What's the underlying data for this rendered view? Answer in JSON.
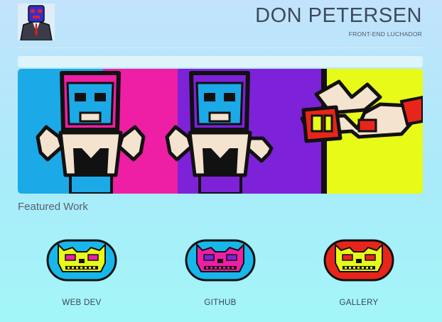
{
  "header": {
    "title": "DON PETERSEN",
    "subtitle": "FRONT-END LUCHADOR"
  },
  "hero": {
    "panel_colors": [
      "#1ba9e8",
      "#ee1fa4",
      "#7d22d8",
      "#e8fa17"
    ],
    "figures": [
      {
        "name": "luchador-pink-mask",
        "mask": "#ee1fa4",
        "mask_inner": "#1ba9e8",
        "shorts": "#1ba9e8"
      },
      {
        "name": "luchador-purple-mask",
        "mask": "#7d22d8",
        "mask_inner": "#1ba9e8",
        "shorts": "#7d22d8"
      },
      {
        "name": "luchador-red-mask",
        "mask": "#e8251b",
        "mask_inner": "#e8fa17"
      }
    ]
  },
  "featured": {
    "heading": "Featured Work",
    "items": [
      {
        "label": "WEB DEV",
        "mask_bg": "#17b7ec",
        "mask_face": "#e8fa17",
        "mask_detail": "#ee1fa4"
      },
      {
        "label": "GITHUB",
        "mask_bg": "#17b7ec",
        "mask_face": "#ee1fa4",
        "mask_detail": "#7d22d8"
      },
      {
        "label": "GALLERY",
        "mask_bg": "#e8251b",
        "mask_face": "#e8fa17",
        "mask_detail": "#e8251b"
      }
    ]
  }
}
